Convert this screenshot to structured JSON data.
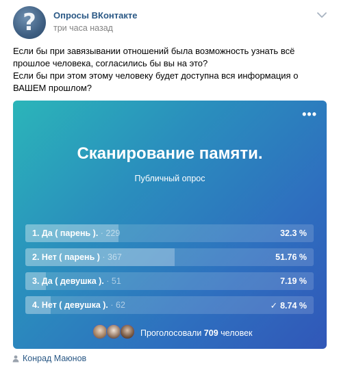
{
  "post": {
    "author": "Опросы ВКонтакте",
    "time": "три часа назад",
    "text_lines": [
      "Если бы при завязывании отношений была возможность узнать всё прошлое человека, согласились бы вы на это?",
      "Если бы при этом этому человеку будет доступна вся информация о ВАШЕМ прошлом?"
    ],
    "signer": "Конрад Маюнов"
  },
  "poll": {
    "menu": "•••",
    "title": "Сканирование памяти.",
    "type": "Публичный опрос",
    "options": [
      {
        "label": "1. Да ( парень ).",
        "count": "· 229",
        "percent": "32.3 %",
        "fraction": 0.323,
        "voted": false
      },
      {
        "label": "2. Нет ( парень )",
        "count": "· 367",
        "percent": "51.76 %",
        "fraction": 0.5176,
        "voted": false
      },
      {
        "label": "3. Да ( девушка ).",
        "count": "· 51",
        "percent": "7.19 %",
        "fraction": 0.0719,
        "voted": false
      },
      {
        "label": "4. Нет ( девушка ).",
        "count": "· 62",
        "percent": "8.74 %",
        "fraction": 0.0874,
        "voted": true
      }
    ],
    "check_glyph": "✓",
    "voters_prefix": "Проголосовали",
    "voters_count": "709",
    "voters_suffix": "человек"
  },
  "colors": {
    "link": "#2a5885",
    "muted": "#828282"
  },
  "icons": {
    "avatar": "question-mark-icon",
    "chevron": "chevron-down-icon",
    "signer": "person-icon"
  }
}
